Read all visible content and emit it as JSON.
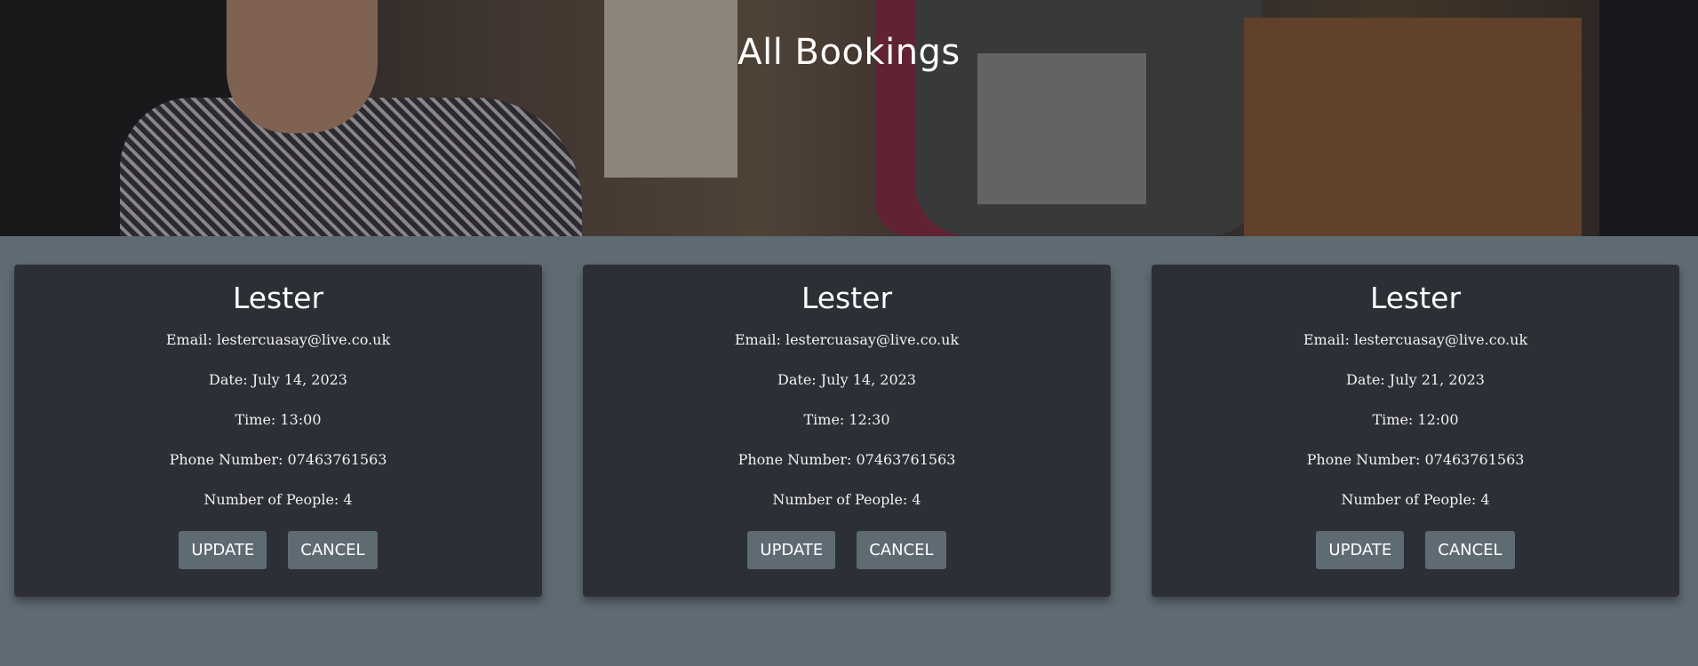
{
  "page": {
    "title": "All Bookings"
  },
  "bookings": [
    {
      "name": "Lester",
      "email_label": "Email:",
      "email": "lestercuasay@live.co.uk",
      "date_label": "Date:",
      "date": "July 14, 2023",
      "time_label": "Time:",
      "time": "13:00",
      "phone_label": "Phone Number:",
      "phone": "07463761563",
      "people_label": "Number of People:",
      "people": "4",
      "update_label": "UPDATE",
      "cancel_label": "CANCEL"
    },
    {
      "name": "Lester",
      "email_label": "Email:",
      "email": "lestercuasay@live.co.uk",
      "date_label": "Date:",
      "date": "July 14, 2023",
      "time_label": "Time:",
      "time": "12:30",
      "phone_label": "Phone Number:",
      "phone": "07463761563",
      "people_label": "Number of People:",
      "people": "4",
      "update_label": "UPDATE",
      "cancel_label": "CANCEL"
    },
    {
      "name": "Lester",
      "email_label": "Email:",
      "email": "lestercuasay@live.co.uk",
      "date_label": "Date:",
      "date": "July 21, 2023",
      "time_label": "Time:",
      "time": "12:00",
      "phone_label": "Phone Number:",
      "phone": "07463761563",
      "people_label": "Number of People:",
      "people": "4",
      "update_label": "UPDATE",
      "cancel_label": "CANCEL"
    }
  ]
}
